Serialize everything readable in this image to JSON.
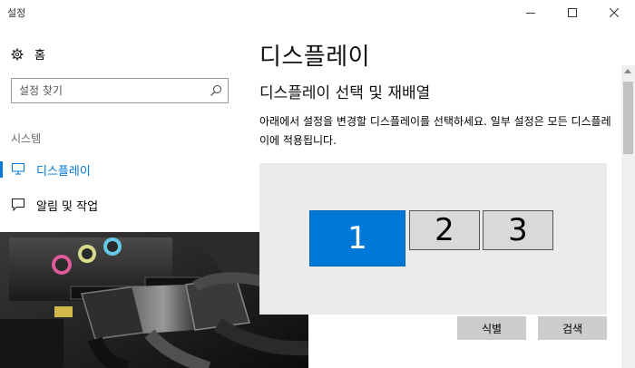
{
  "window": {
    "title": "설정",
    "controls": {
      "minimize_icon": "minimize-icon",
      "maximize_icon": "maximize-icon",
      "close_icon": "close-icon"
    }
  },
  "sidebar": {
    "home_label": "홈",
    "search_placeholder": "설정 찾기",
    "section_label": "시스템",
    "items": [
      {
        "label": "디스플레이",
        "icon": "monitor-icon",
        "active": true
      },
      {
        "label": "알림 및 작업",
        "icon": "notification-icon",
        "active": false
      }
    ]
  },
  "main": {
    "title": "디스플레이",
    "subtitle": "디스플레이 선택 및 재배열",
    "description": "아래에서 설정을 변경할 디스플레이를 선택하세요. 일부 설정은 모든 디스플레이에 적용됩니다.",
    "displays": [
      {
        "number": "1",
        "selected": true
      },
      {
        "number": "2",
        "selected": false
      },
      {
        "number": "3",
        "selected": false
      }
    ],
    "identify_label": "식별",
    "detect_label": "검색"
  },
  "colors": {
    "accent": "#0078d7",
    "selected_monitor": "#0078d7",
    "unselected_monitor": "#d9d9d9",
    "arrange_area": "#ebebeb",
    "button": "#cccccc"
  }
}
